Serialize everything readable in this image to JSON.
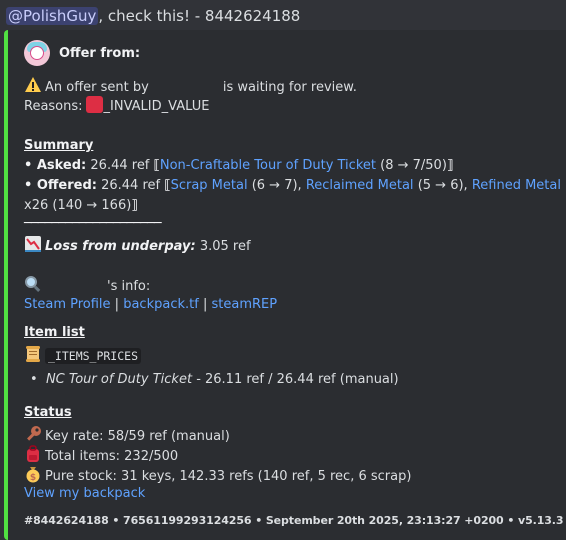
{
  "header": {
    "mention": "@PolishGuy",
    "text": ", check this! - 8442624188"
  },
  "author": {
    "name": "Offer from:"
  },
  "review": {
    "pre": "An offer sent by",
    "post": "is waiting for review.",
    "reasons_label": "Reasons:",
    "reason": "_INVALID_VALUE"
  },
  "summary": {
    "title": "Summary",
    "asked_label": "• Asked:",
    "asked_value": "26.44 ref",
    "asked_item": "Non-Craftable Tour of Duty Ticket",
    "asked_qty": "(8 → 7/50)",
    "offered_label": "• Offered:",
    "offered_value": "26.44 ref",
    "offered_item1": "Scrap Metal",
    "offered_qty1": "(6 → 7),",
    "offered_item2": "Reclaimed Metal",
    "offered_qty2": "(5 → 6),",
    "offered_item3": "Refined Metal",
    "offered_line2": "x26 (140 → 166)",
    "divider": "────────────────────",
    "loss_label": "Loss from underpay:",
    "loss_value": "3.05 ref"
  },
  "info": {
    "suffix": "'s info:",
    "links": [
      "Steam Profile",
      "backpack.tf",
      "steamREP"
    ],
    "sep": "|"
  },
  "items": {
    "title": "Item list",
    "code": "_ITEMS_PRICES",
    "entry_name": "NC Tour of Duty Ticket",
    "entry_rest": "- 26.11 ref / 26.44 ref (manual)"
  },
  "status": {
    "title": "Status",
    "key_rate": "Key rate: 58/59 ref (manual)",
    "total_items": "Total items: 232/500",
    "pure_stock": "Pure stock: 31 keys, 142.33 refs (140 ref, 5 rec, 6 scrap)",
    "backpack_link": "View my backpack"
  },
  "footer": {
    "text": "#8442624188 • 76561199293124256 • September 20th 2025, 23:13:27 +0200 • v5.13.3"
  },
  "colors": {
    "accent": "#51e042",
    "link": "#5fa2ff",
    "background": "#313338",
    "embed": "#2b2d31"
  },
  "icons": [
    "warning-icon",
    "red-square-icon",
    "chart-down-icon",
    "magnifier-icon",
    "scroll-icon",
    "key-icon",
    "backpack-icon",
    "money-bag-icon"
  ]
}
